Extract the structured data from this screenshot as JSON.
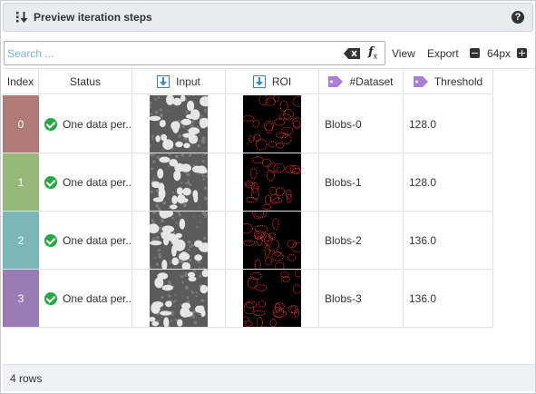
{
  "panel": {
    "title": "Preview iteration steps",
    "help_symbol": "?"
  },
  "toolbar": {
    "search_placeholder": "Search ...",
    "view_label": "View",
    "export_label": "Export",
    "zoom_value": "64px"
  },
  "table": {
    "headers": {
      "index": "Index",
      "status": "Status",
      "input": "Input",
      "roi": "ROI",
      "dataset": "#Dataset",
      "threshold": "Threshold"
    },
    "rows": [
      {
        "index": "0",
        "color": "#b07a78",
        "status": "One data per...",
        "dataset": "Blobs-0",
        "threshold": "128.0"
      },
      {
        "index": "1",
        "color": "#97b878",
        "status": "One data per...",
        "dataset": "Blobs-1",
        "threshold": "128.0"
      },
      {
        "index": "2",
        "color": "#7bb7b6",
        "status": "One data per...",
        "dataset": "Blobs-2",
        "threshold": "136.0"
      },
      {
        "index": "3",
        "color": "#9a7cb4",
        "status": "One data per...",
        "dataset": "Blobs-3",
        "threshold": "136.0"
      }
    ]
  },
  "footer": {
    "row_count": "4 rows"
  },
  "icons": {
    "title": "sort-down-icon",
    "help": "help-circle-icon",
    "clear": "backspace-clear-icon",
    "fx": "function-fx-icon",
    "zoom_out": "minus-square-icon",
    "zoom_in": "plus-square-icon",
    "input_header": "data-import-icon",
    "roi_header": "data-import-icon",
    "dataset_header": "tag-icon",
    "threshold_header": "tag-icon",
    "status": "check-circle-icon"
  },
  "colors": {
    "accent_blue": "#2d8ad8",
    "tag_purple": "#a87fd6",
    "ok_green": "#28a745",
    "roi_red": "#ff3030"
  }
}
